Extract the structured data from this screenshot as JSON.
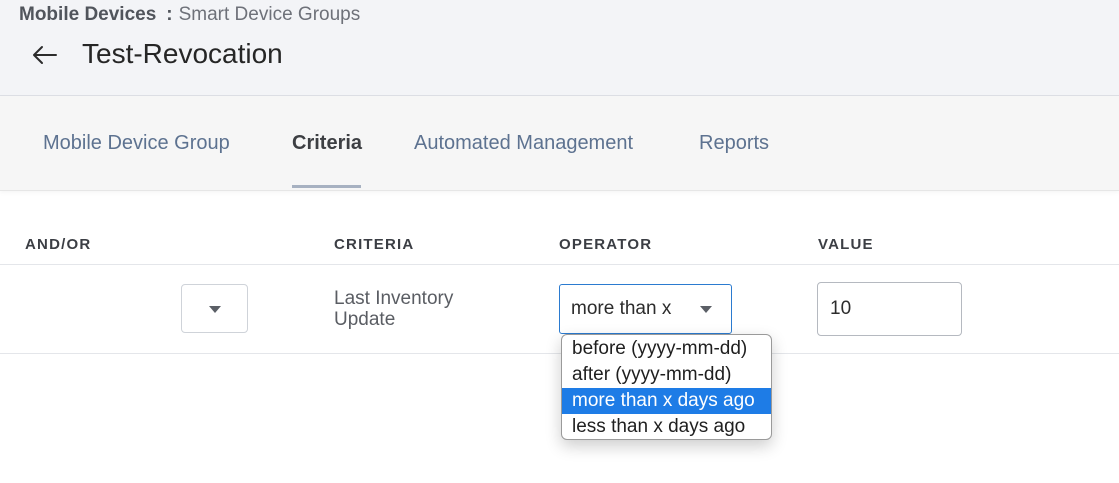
{
  "breadcrumb": {
    "root": "Mobile Devices",
    "separator": ":",
    "current": "Smart Device Groups"
  },
  "back_icon": "arrow-left-icon",
  "page_title": "Test-Revocation",
  "tabs": [
    {
      "label": "Mobile Device Group",
      "active": false
    },
    {
      "label": "Criteria",
      "active": true
    },
    {
      "label": "Automated Management",
      "active": false
    },
    {
      "label": "Reports",
      "active": false
    }
  ],
  "table": {
    "headers": {
      "andor": "AND/OR",
      "criteria": "CRITERIA",
      "operator": "OPERATOR",
      "value": "VALUE"
    },
    "rows": [
      {
        "andor": "",
        "criteria": "Last Inventory Update",
        "operator": "more than x",
        "value": "10"
      }
    ]
  },
  "operator_dropdown": {
    "options": [
      "before (yyyy-mm-dd)",
      "after (yyyy-mm-dd)",
      "more than x days ago",
      "less than x days ago"
    ],
    "highlighted": "more than x days ago"
  },
  "colors": {
    "accent": "#1e7ce6",
    "tab_inactive": "#5d7290",
    "header_bg": "#f3f4f7"
  }
}
